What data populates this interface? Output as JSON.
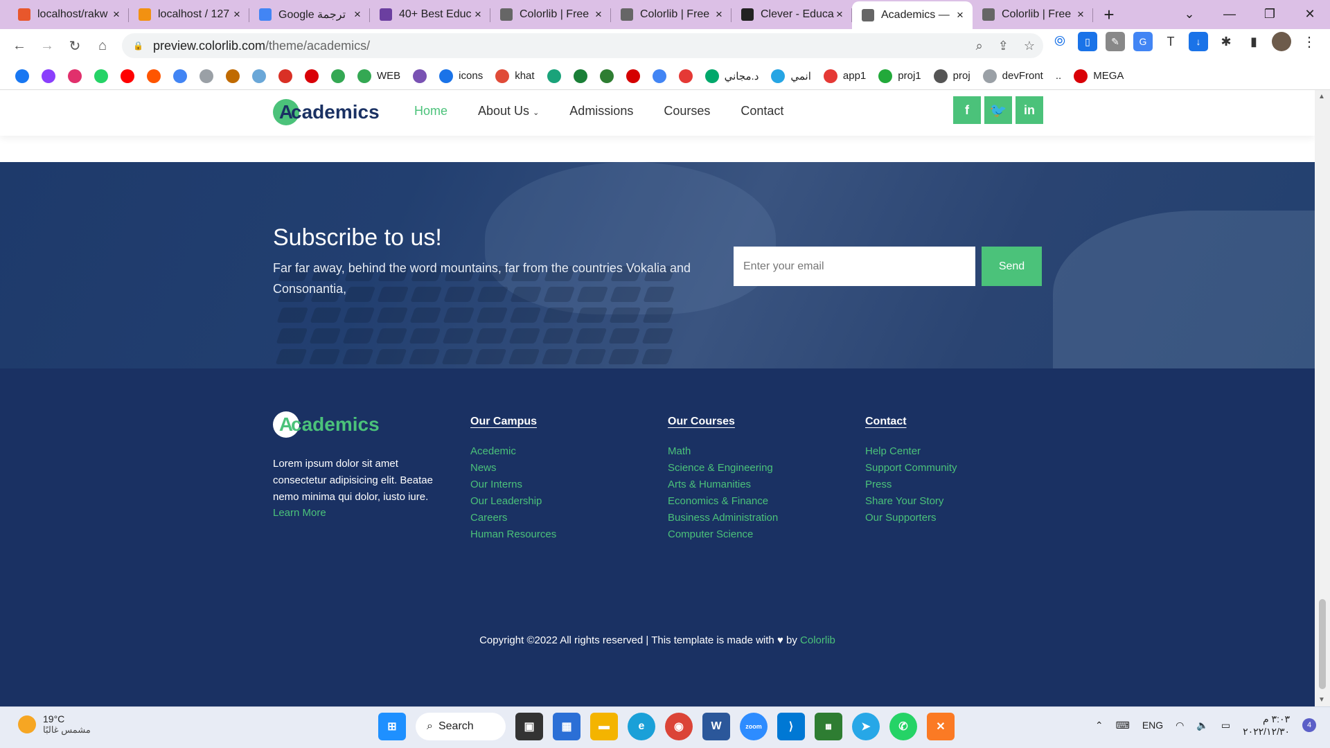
{
  "browser": {
    "tabs": [
      {
        "title": "localhost/rakw",
        "icon": "xampp-icon",
        "color": "#e8572c"
      },
      {
        "title": "localhost / 127",
        "icon": "phpmyadmin-icon",
        "color": "#f29111"
      },
      {
        "title": "Google ترجمة",
        "icon": "google-translate-icon",
        "color": "#4285f4"
      },
      {
        "title": "40+ Best Educ",
        "icon": "colorlib-icon",
        "color": "#6b3fa0"
      },
      {
        "title": "Colorlib | Free",
        "icon": "globe-icon",
        "color": "#666666"
      },
      {
        "title": "Colorlib | Free",
        "icon": "globe-icon",
        "color": "#666666"
      },
      {
        "title": "Clever - Educa",
        "icon": "clever-icon",
        "color": "#222222"
      },
      {
        "title": "Academics —",
        "icon": "globe-icon",
        "color": "#666666",
        "active": true
      },
      {
        "title": "Colorlib | Free",
        "icon": "globe-icon",
        "color": "#666666"
      }
    ],
    "url_host": "preview.colorlib.com",
    "url_path": "/theme/academics/",
    "bookmarks": [
      {
        "label": "",
        "icon": "facebook-icon",
        "color": "#1877f2"
      },
      {
        "label": "",
        "icon": "messenger-icon",
        "color": "#8a3ffc"
      },
      {
        "label": "",
        "icon": "instagram-icon",
        "color": "#e1306c"
      },
      {
        "label": "",
        "icon": "whatsapp-icon",
        "color": "#25d366"
      },
      {
        "label": "",
        "icon": "youtube-icon",
        "color": "#ff0000"
      },
      {
        "label": "",
        "icon": "soundcloud-icon",
        "color": "#ff5500"
      },
      {
        "label": "",
        "icon": "translate-icon",
        "color": "#4285f4"
      },
      {
        "label": "",
        "icon": "page-icon",
        "color": "#9aa0a6"
      },
      {
        "label": "",
        "icon": "hm-icon",
        "color": "#c06a00"
      },
      {
        "label": "",
        "icon": "wave-icon",
        "color": "#6aa7d8"
      },
      {
        "label": "",
        "icon": "calendar-icon",
        "color": "#d93025"
      },
      {
        "label": "",
        "icon": "mega-red-icon",
        "color": "#d90007"
      },
      {
        "label": "",
        "icon": "drive-icon",
        "color": "#34a853"
      },
      {
        "label": "WEB",
        "icon": "drive-icon",
        "color": "#34a853"
      },
      {
        "label": "",
        "icon": "bootstrap-icon",
        "color": "#7952b3"
      },
      {
        "label": "icons",
        "icon": "flag-icon",
        "color": "#1a73e8"
      },
      {
        "label": "khat",
        "icon": "puzzle-icon",
        "color": "#e04b38"
      },
      {
        "label": "",
        "icon": "diamond-icon",
        "color": "#1aa37a"
      },
      {
        "label": "",
        "icon": "w-icon",
        "color": "#1a7f37"
      },
      {
        "label": "",
        "icon": "ae-icon",
        "color": "#2e7d32"
      },
      {
        "label": "",
        "icon": "v-icon",
        "color": "#d50000"
      },
      {
        "label": "",
        "icon": "google-icon",
        "color": "#4285f4"
      },
      {
        "label": "",
        "icon": "sg-icon",
        "color": "#e53935"
      },
      {
        "label": "د.مجاني",
        "icon": "shield-icon",
        "color": "#00a86b"
      },
      {
        "label": "انمي",
        "icon": "anime-icon",
        "color": "#26a5e4"
      },
      {
        "label": "app1",
        "icon": "s-icon",
        "color": "#e53935"
      },
      {
        "label": "proj1",
        "icon": "check-icon",
        "color": "#22a93a"
      },
      {
        "label": "proj",
        "icon": "globe-icon",
        "color": "#555555"
      },
      {
        "label": "devFront",
        "icon": "dev-icon",
        "color": "#9aa0a6"
      },
      {
        "label": "..",
        "icon": "",
        "color": "#ffffff"
      },
      {
        "label": "MEGA",
        "icon": "mega-icon",
        "color": "#d90007"
      }
    ]
  },
  "site": {
    "logo_initial": "A",
    "logo_rest": "cademics",
    "nav": [
      "Home",
      "About Us",
      "Admissions",
      "Courses",
      "Contact"
    ],
    "socials": [
      "f",
      "t",
      "in"
    ],
    "accent": "#4bc27a",
    "navy": "#1a3163"
  },
  "subscribe": {
    "title": "Subscribe to us!",
    "text": "Far far away, behind the word mountains, far from the countries Vokalia and Consonantia,",
    "placeholder": "Enter your email",
    "button": "Send"
  },
  "footer": {
    "description": "Lorem ipsum dolor sit amet consectetur adipisicing elit. Beatae nemo minima qui dolor, iusto iure.",
    "learn_more": "Learn More",
    "campus": {
      "title": "Our Campus",
      "links": [
        "Acedemic",
        "News",
        "Our Interns",
        "Our Leadership",
        "Careers",
        "Human Resources"
      ]
    },
    "courses": {
      "title": "Our Courses",
      "links": [
        "Math",
        "Science & Engineering",
        "Arts & Humanities",
        "Economics & Finance",
        "Business Administration",
        "Computer Science"
      ]
    },
    "contact": {
      "title": "Contact",
      "links": [
        "Help Center",
        "Support Community",
        "Press",
        "Share Your Story",
        "Our Supporters"
      ]
    },
    "copyright_prefix": "Copyright ©2022 All rights reserved | This template is made with",
    "copyright_by": "by",
    "copyright_link": "Colorlib"
  },
  "taskbar": {
    "temp": "19°C",
    "weather": "مشمس غالبًا",
    "search": "Search",
    "lang": "ENG",
    "time": "٣:٠٣ م",
    "date": "٢٠٢٢/١٢/٣٠",
    "notifications": "4"
  }
}
